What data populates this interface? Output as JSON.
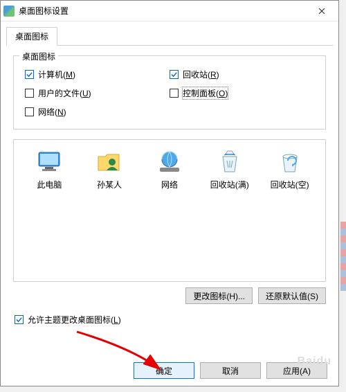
{
  "title": "桌面图标设置",
  "tab": {
    "label": "桌面图标"
  },
  "group": {
    "title": "桌面图标",
    "items": [
      {
        "label": "计算机(M)",
        "checked": true,
        "hotkey": "M"
      },
      {
        "label": "回收站(R)",
        "checked": true,
        "hotkey": "R"
      },
      {
        "label": "用户的文件(U)",
        "checked": false,
        "hotkey": "U"
      },
      {
        "label": "控制面板(O)",
        "checked": false,
        "hotkey": "O",
        "focused": true
      },
      {
        "label": "网络(N)",
        "checked": false,
        "hotkey": "N"
      }
    ]
  },
  "icons": [
    {
      "label": "此电脑",
      "kind": "monitor"
    },
    {
      "label": "孙某人",
      "kind": "user-folder"
    },
    {
      "label": "网络",
      "kind": "network"
    },
    {
      "label": "回收站(满)",
      "kind": "bin-full"
    },
    {
      "label": "回收站(空)",
      "kind": "bin-empty"
    }
  ],
  "buttons": {
    "change_icon": "更改图标(H)...",
    "restore_default": "还原默认值(S)"
  },
  "theme_check": {
    "label": "允许主题更改桌面图标(L)",
    "checked": true
  },
  "dialog": {
    "ok": "确定",
    "cancel": "取消",
    "apply": "应用(A)"
  },
  "watermark": "Baidu"
}
